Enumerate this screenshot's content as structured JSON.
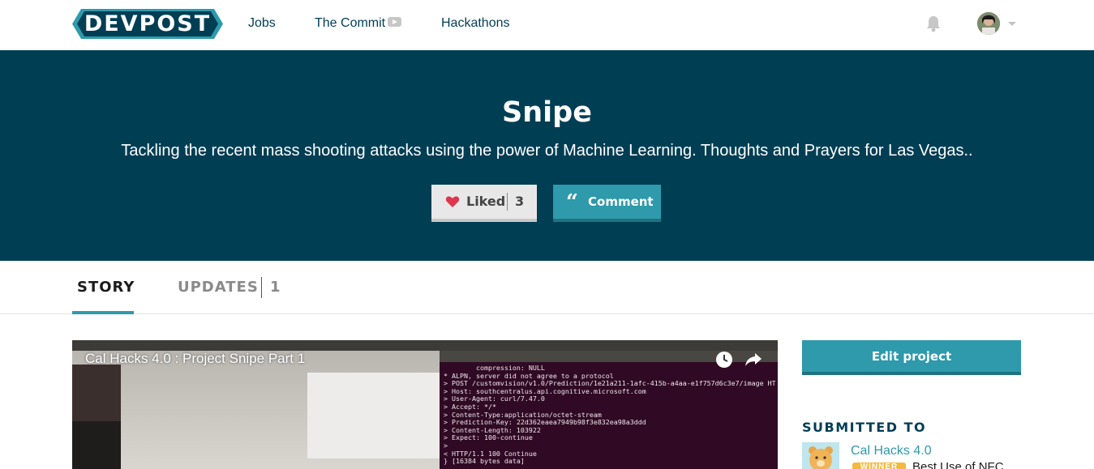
{
  "nav": {
    "logo": "DEVPOST",
    "links": [
      "Jobs",
      "The Commit",
      "Hackathons"
    ],
    "icons": [
      "youtube-icon",
      "bell-icon",
      "avatar",
      "chevron-down-icon"
    ]
  },
  "project": {
    "title": "Snipe",
    "tagline": "Tackling the recent mass shooting attacks using the power of Machine Learning. Thoughts and Prayers for Las Vegas..",
    "like_label": "Liked",
    "like_count": "3",
    "comment_label": "Comment"
  },
  "tabs": {
    "story": "STORY",
    "updates": "UPDATES",
    "updates_count": "1"
  },
  "video": {
    "title": "Cal Hacks 4.0 : Project Snipe Part 1",
    "terminal_lines": [
      "        compression: NULL",
      "* ALPN, server did not agree to a protocol",
      "> POST /customvision/v1.0/Prediction/1e21a211-1afc-415b-a4aa-e1f757d6c3e7/image HT",
      "> Host: southcentralus.api.cognitive.microsoft.com",
      "> User-Agent: curl/7.47.0",
      "> Accept: */*",
      "> Content-Type:application/octet-stream",
      "> Prediction-Key: 22d362eaea7949b98f3e832ea98a3ddd",
      "> Content-Length: 103922",
      "> Expect: 100-continue",
      ">",
      "< HTTP/1.1 100 Continue",
      "} [16384 bytes data]"
    ]
  },
  "sidebar": {
    "edit_label": "Edit project",
    "submitted_heading": "SUBMITTED TO",
    "hackathon_name": "Cal Hacks 4.0",
    "winner_badge": "WINNER",
    "prize": "Best Use of NFC"
  },
  "colors": {
    "navy": "#003e54",
    "teal": "#2e9aab",
    "heart": "#e0364b",
    "winner": "#f2b93b"
  }
}
